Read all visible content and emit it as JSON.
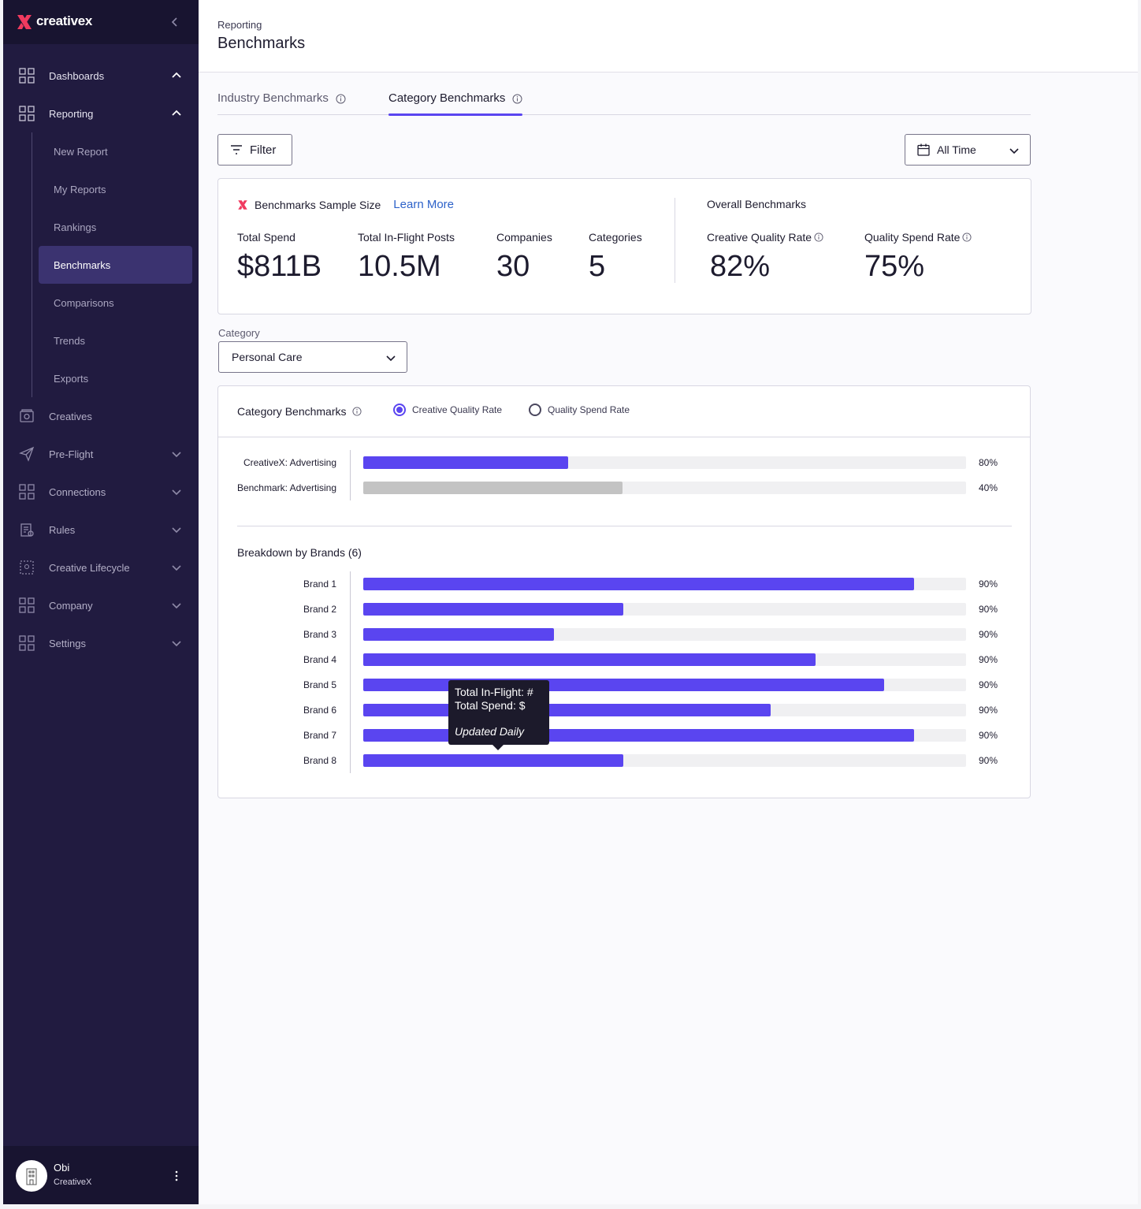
{
  "brand": {
    "name": "creativex",
    "accent": "#f03a5f"
  },
  "sidebar": {
    "nav": [
      {
        "label": "Dashboards",
        "icon": "grid-icon",
        "expanded": true
      },
      {
        "label": "Reporting",
        "icon": "grid-icon",
        "expanded": true
      }
    ],
    "reporting_items": [
      {
        "label": "New Report"
      },
      {
        "label": "My Reports"
      },
      {
        "label": "Rankings"
      },
      {
        "label": "Benchmarks",
        "active": true
      },
      {
        "label": "Comparisons"
      },
      {
        "label": "Trends"
      },
      {
        "label": "Exports"
      }
    ],
    "lower_nav": [
      {
        "label": "Creatives",
        "icon": "creatives-icon"
      },
      {
        "label": "Pre-Flight",
        "icon": "paper-plane-icon"
      },
      {
        "label": "Connections",
        "icon": "grid-icon"
      },
      {
        "label": "Rules",
        "icon": "rules-icon"
      },
      {
        "label": "Creative Lifecycle",
        "icon": "lifecycle-icon"
      },
      {
        "label": "Company",
        "icon": "grid-icon"
      },
      {
        "label": "Settings",
        "icon": "grid-icon"
      }
    ],
    "user": {
      "name": "Obi",
      "org": "CreativeX"
    }
  },
  "header": {
    "breadcrumb": "Reporting",
    "title": "Benchmarks"
  },
  "tabs": [
    {
      "label": "Industry Benchmarks",
      "active": false
    },
    {
      "label": "Category Benchmarks",
      "active": true
    }
  ],
  "toolbar": {
    "filter_label": "Filter",
    "time_range": "All Time"
  },
  "sample": {
    "title": "Benchmarks Sample Size",
    "learn_more": "Learn More",
    "overall_title": "Overall Benchmarks",
    "stats": [
      {
        "label": "Total Spend",
        "value": "$811B"
      },
      {
        "label": "Total In-Flight Posts",
        "value": "10.5M"
      },
      {
        "label": "Companies",
        "value": "30"
      },
      {
        "label": "Categories",
        "value": "5"
      }
    ],
    "overall": [
      {
        "label": "Creative Quality Rate",
        "value": "82%"
      },
      {
        "label": "Quality Spend Rate",
        "value": "75%"
      }
    ]
  },
  "category": {
    "label": "Category",
    "selected": "Personal Care"
  },
  "chart_panel": {
    "title": "Category Benchmarks",
    "metric_options": [
      {
        "label": "Creative Quality Rate",
        "selected": true
      },
      {
        "label": "Quality Spend Rate",
        "selected": false
      }
    ],
    "breakdown_title": "Breakdown by Brands (6)",
    "tooltip": {
      "line1": "Total In-Flight: #",
      "line2": "Total Spend: $",
      "note": "Updated Daily"
    }
  },
  "chart_data": [
    {
      "type": "bar",
      "orientation": "horizontal",
      "categories": [
        "CreativeX: Advertising",
        "Benchmark: Advertising"
      ],
      "values": [
        0.34,
        0.43
      ],
      "value_labels": [
        "80%",
        "40%"
      ],
      "colors": [
        "#5a45f0",
        "#c3c3c3"
      ],
      "xlim": [
        0,
        1
      ]
    },
    {
      "type": "bar",
      "orientation": "horizontal",
      "title": "Breakdown by Brands (6)",
      "categories": [
        "Brand 1",
        "Brand 2",
        "Brand 3",
        "Brand 4",
        "Brand 5",
        "Brand 6",
        "Brand 7",
        "Brand 8"
      ],
      "values": [
        0.914,
        0.431,
        0.316,
        0.75,
        0.864,
        0.676,
        0.914,
        0.431
      ],
      "value_labels": [
        "90%",
        "90%",
        "90%",
        "90%",
        "90%",
        "90%",
        "90%",
        "90%"
      ],
      "colors": [
        "#5a45f0"
      ],
      "xlim": [
        0,
        1
      ]
    }
  ]
}
